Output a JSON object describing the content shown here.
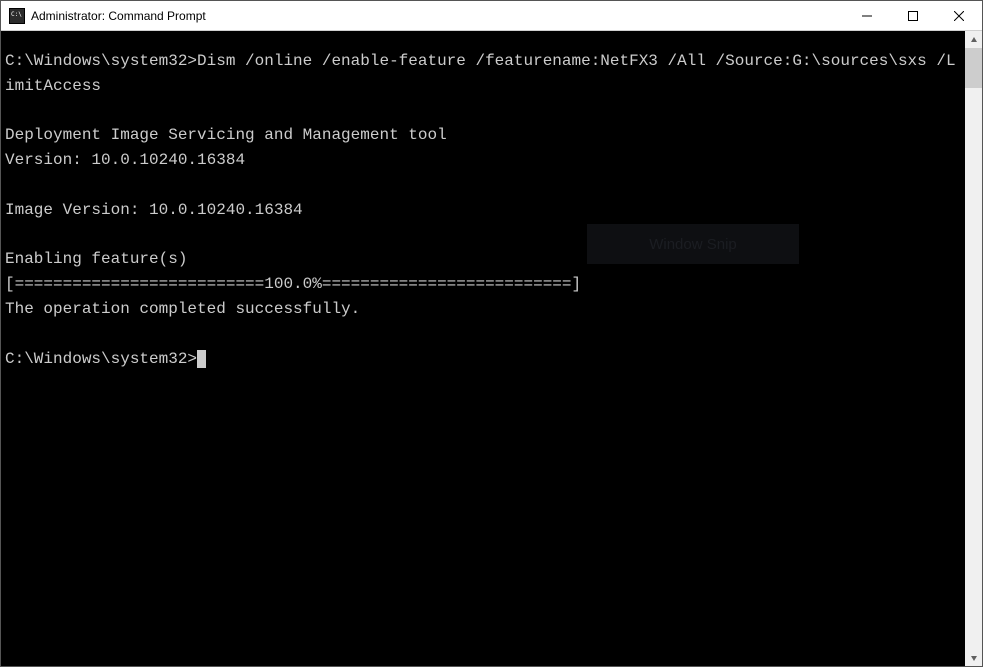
{
  "window": {
    "title": "Administrator: Command Prompt"
  },
  "terminal": {
    "line1": "C:\\Windows\\system32>Dism /online /enable-feature /featurename:NetFX3 /All /Source:G:\\sources\\sxs /LimitAccess",
    "line2": "",
    "line3": "Deployment Image Servicing and Management tool",
    "line4": "Version: 10.0.10240.16384",
    "line5": "",
    "line6": "Image Version: 10.0.10240.16384",
    "line7": "",
    "line8": "Enabling feature(s)",
    "line9": "[==========================100.0%==========================]",
    "line10": "The operation completed successfully.",
    "line11": "",
    "line12": "C:\\Windows\\system32>"
  },
  "overlay": {
    "snip_label": "Window Snip"
  }
}
